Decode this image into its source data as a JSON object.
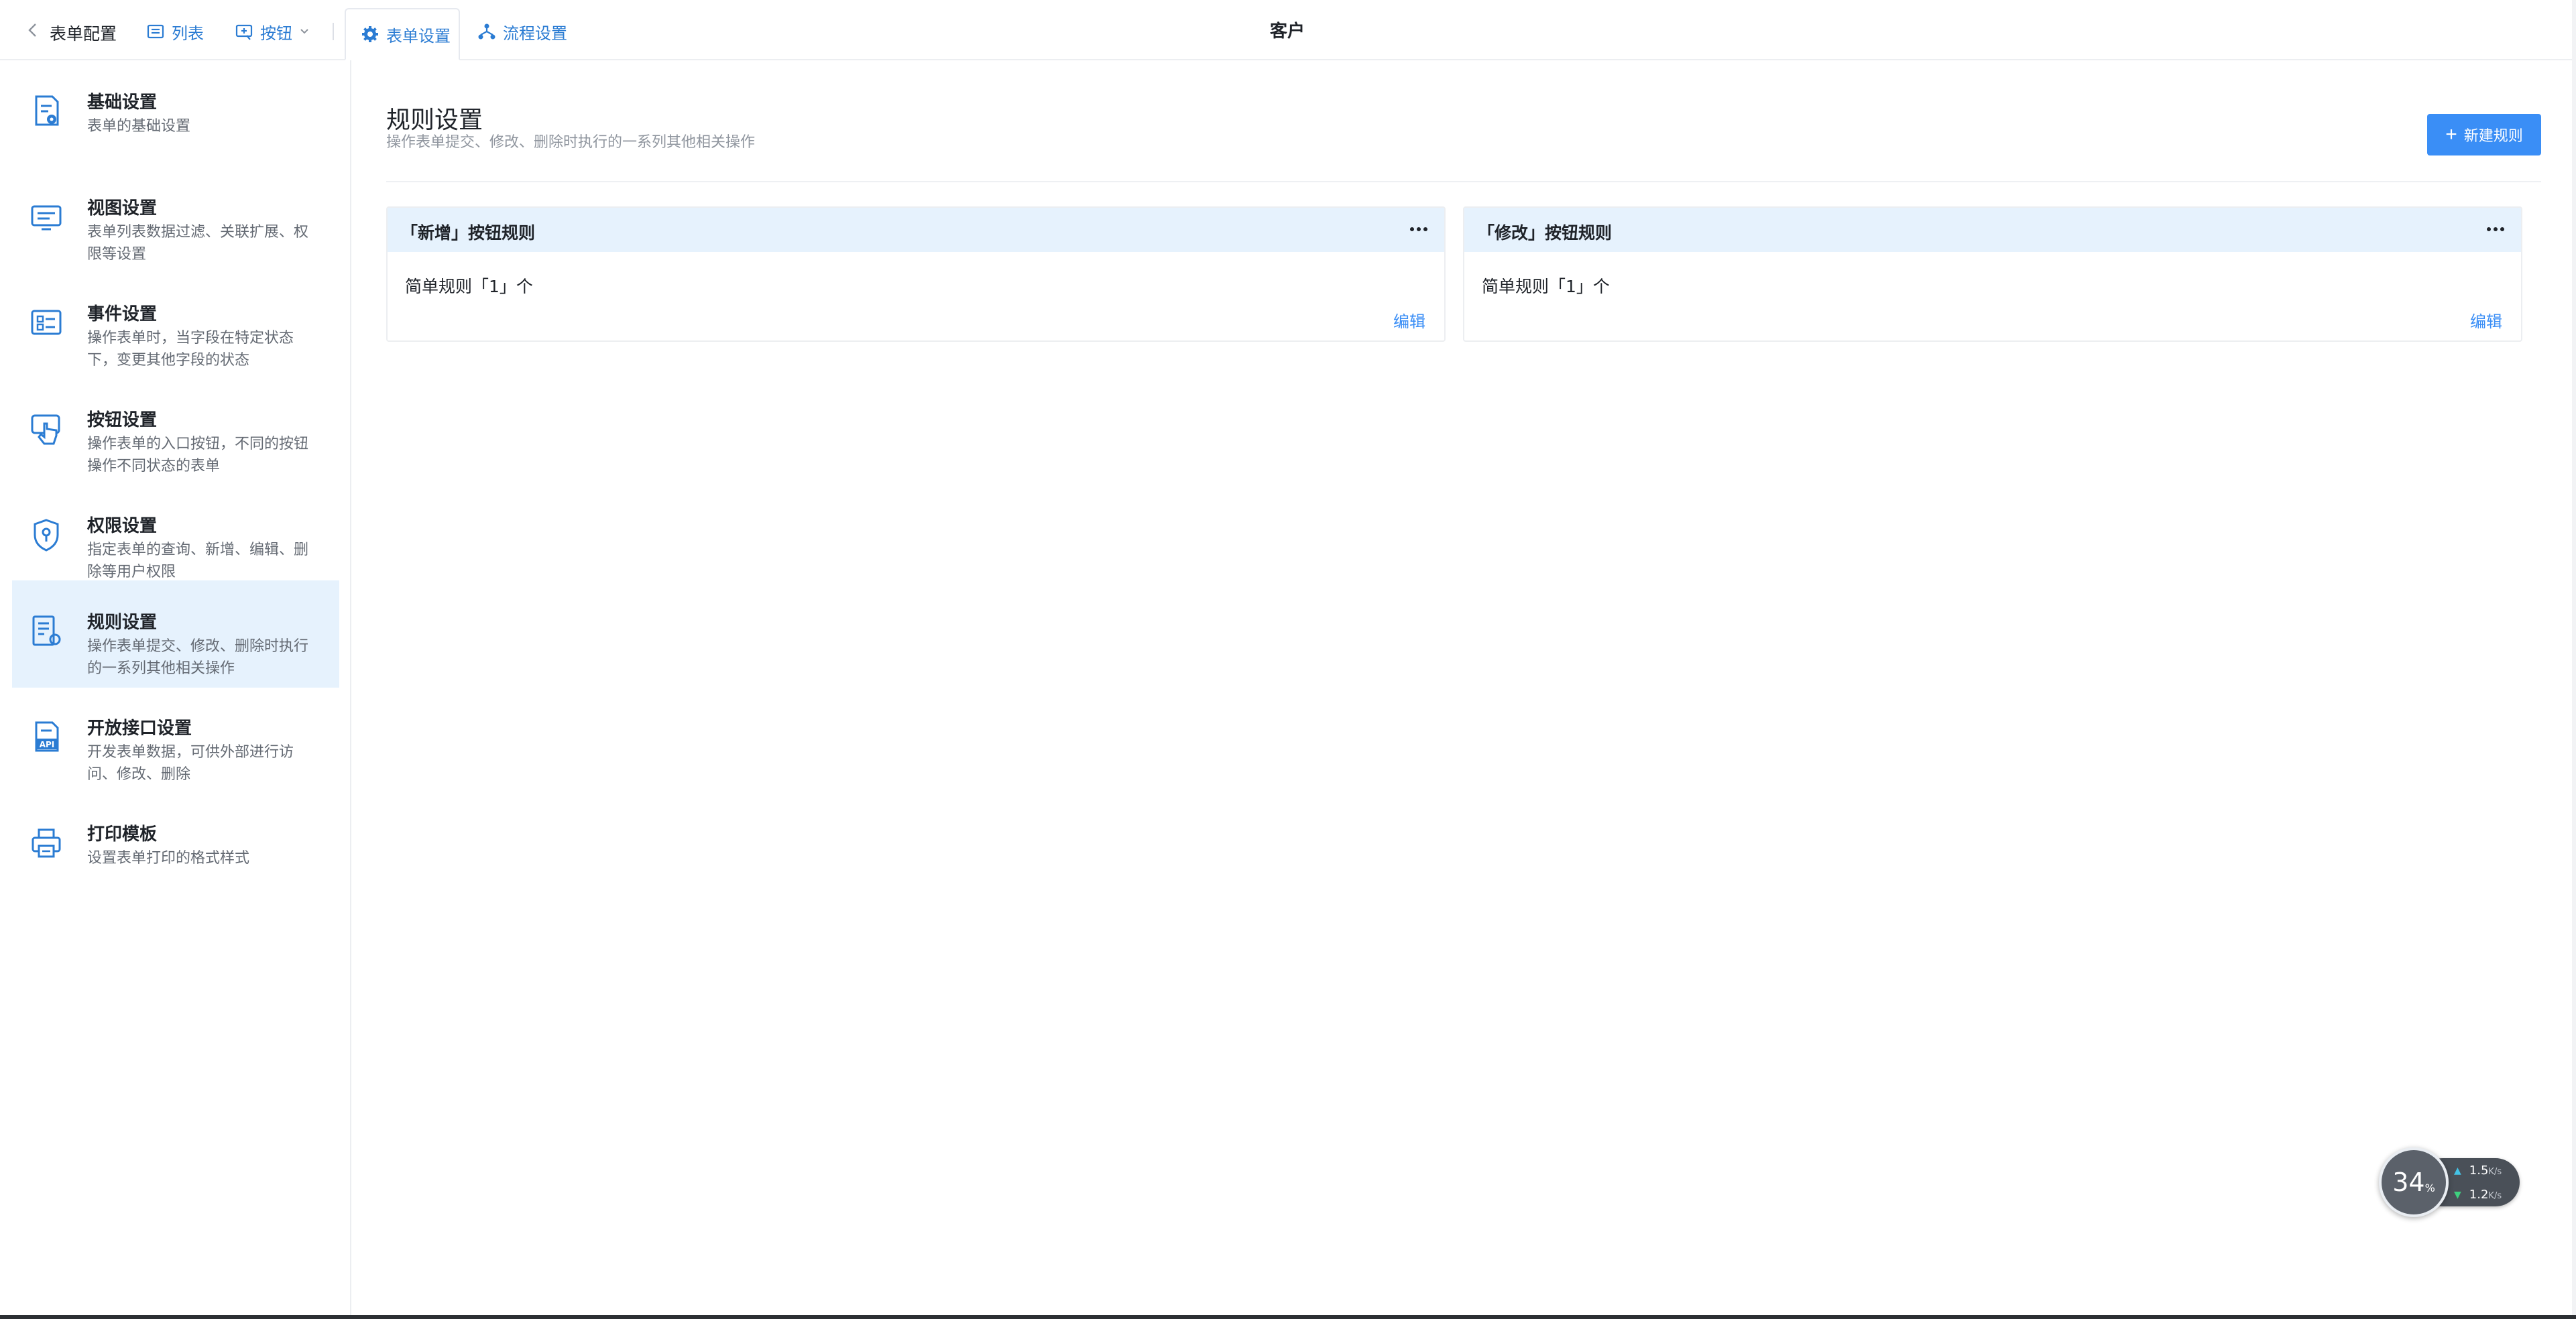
{
  "topbar": {
    "back_icon": "chevron-left-icon",
    "app_title": "表单配置",
    "tab_list": "列表",
    "tab_button": "按钮",
    "tab_form_settings": "表单设置",
    "tab_flow_settings": "流程设置",
    "center_title": "客户"
  },
  "sidebar": {
    "items": [
      {
        "title": "基础设置",
        "desc": "表单的基础设置",
        "icon": "form-settings-icon"
      },
      {
        "title": "视图设置",
        "desc": "表单列表数据过滤、关联扩展、权限等设置",
        "icon": "monitor-icon"
      },
      {
        "title": "事件设置",
        "desc": "操作表单时，当字段在特定状态下，变更其他字段的状态",
        "icon": "event-icon"
      },
      {
        "title": "按钮设置",
        "desc": "操作表单的入口按钮，不同的按钮操作不同状态的表单",
        "icon": "touch-button-icon"
      },
      {
        "title": "权限设置",
        "desc": "指定表单的查询、新增、编辑、删除等用户权限",
        "icon": "shield-icon"
      },
      {
        "title": "规则设置",
        "desc": "操作表单提交、修改、删除时执行的一系列其他相关操作",
        "icon": "rules-icon"
      },
      {
        "title": "开放接口设置",
        "desc": "开发表单数据，可供外部进行访问、修改、删除",
        "icon": "api-icon"
      },
      {
        "title": "打印模板",
        "desc": "设置表单打印的格式样式",
        "icon": "printer-icon"
      }
    ],
    "active_index": 5
  },
  "main": {
    "title": "规则设置",
    "subtitle": "操作表单提交、修改、删除时执行的一系列其他相关操作",
    "new_rule_label": "新建规则",
    "cards": [
      {
        "title": "「新增」按钮规则",
        "count_text": "简单规则「1」个",
        "edit_label": "编辑"
      },
      {
        "title": "「修改」按钮规则",
        "count_text": "简单规则「1」个",
        "edit_label": "编辑"
      }
    ]
  },
  "monitor": {
    "percent": "34",
    "percent_unit": "%",
    "up_speed": "1.5",
    "down_speed": "1.2",
    "speed_unit": "K/s"
  },
  "colors": {
    "accent": "#3a8ef6",
    "link": "#2b7cd3",
    "active_bg": "#e6f2fd"
  }
}
